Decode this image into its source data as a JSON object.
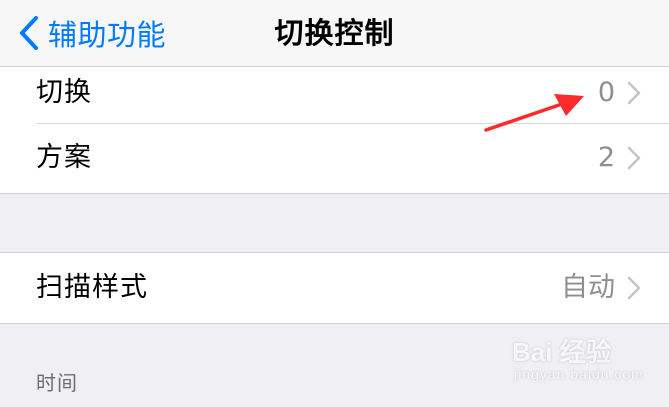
{
  "navbar": {
    "back_label": "辅助功能",
    "title": "切换控制",
    "accent_color": "#007aff"
  },
  "group1": {
    "rows": [
      {
        "label": "切换",
        "value": "0"
      },
      {
        "label": "方案",
        "value": "2"
      }
    ]
  },
  "group2": {
    "rows": [
      {
        "label": "扫描样式",
        "value": "自动"
      }
    ]
  },
  "section": {
    "time_header": "时间"
  },
  "annotation": {
    "arrow_color": "#ff2a2a"
  },
  "watermark": {
    "main": "Bai 经验",
    "sub": "jingyan.baidu.com"
  }
}
